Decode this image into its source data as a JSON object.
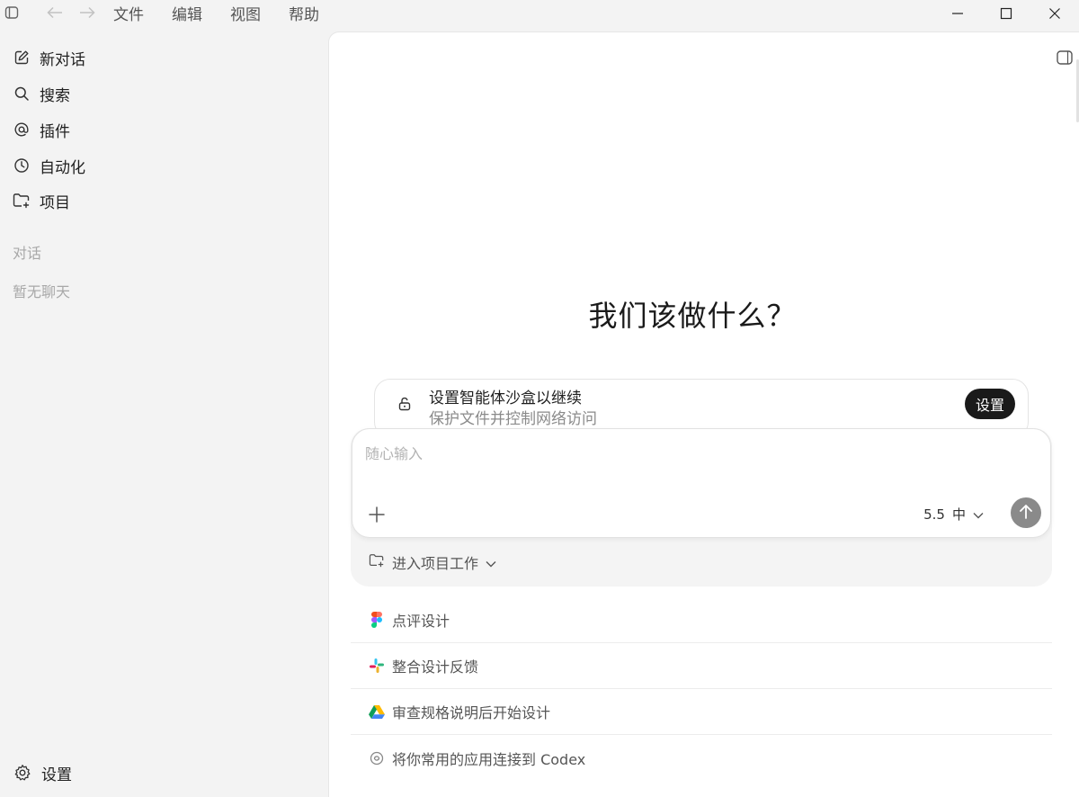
{
  "menu": [
    "文件",
    "编辑",
    "视图",
    "帮助"
  ],
  "sidebar": {
    "items": [
      {
        "label": "新对话",
        "icon": "edit-icon"
      },
      {
        "label": "搜索",
        "icon": "search-icon"
      },
      {
        "label": "插件",
        "icon": "at-icon"
      },
      {
        "label": "自动化",
        "icon": "clock-icon"
      },
      {
        "label": "项目",
        "icon": "folder-add-icon"
      }
    ],
    "section_title": "对话",
    "empty_text": "暂无聊天",
    "settings_label": "设置"
  },
  "main": {
    "heading": "我们该做什么？",
    "sandbox": {
      "title": "设置智能体沙盒以继续",
      "subtitle": "保护文件并控制网络访问",
      "button": "设置"
    },
    "composer": {
      "placeholder": "随心输入",
      "model_version": "5.5",
      "model_level": "中"
    },
    "project_select": "进入项目工作",
    "suggestions": [
      {
        "label": "点评设计",
        "icon": "figma-icon"
      },
      {
        "label": "整合设计反馈",
        "icon": "slack-icon"
      },
      {
        "label": "审查规格说明后开始设计",
        "icon": "google-drive-icon"
      },
      {
        "label": "将你常用的应用连接到 Codex",
        "icon": "connect-app-icon"
      }
    ]
  }
}
